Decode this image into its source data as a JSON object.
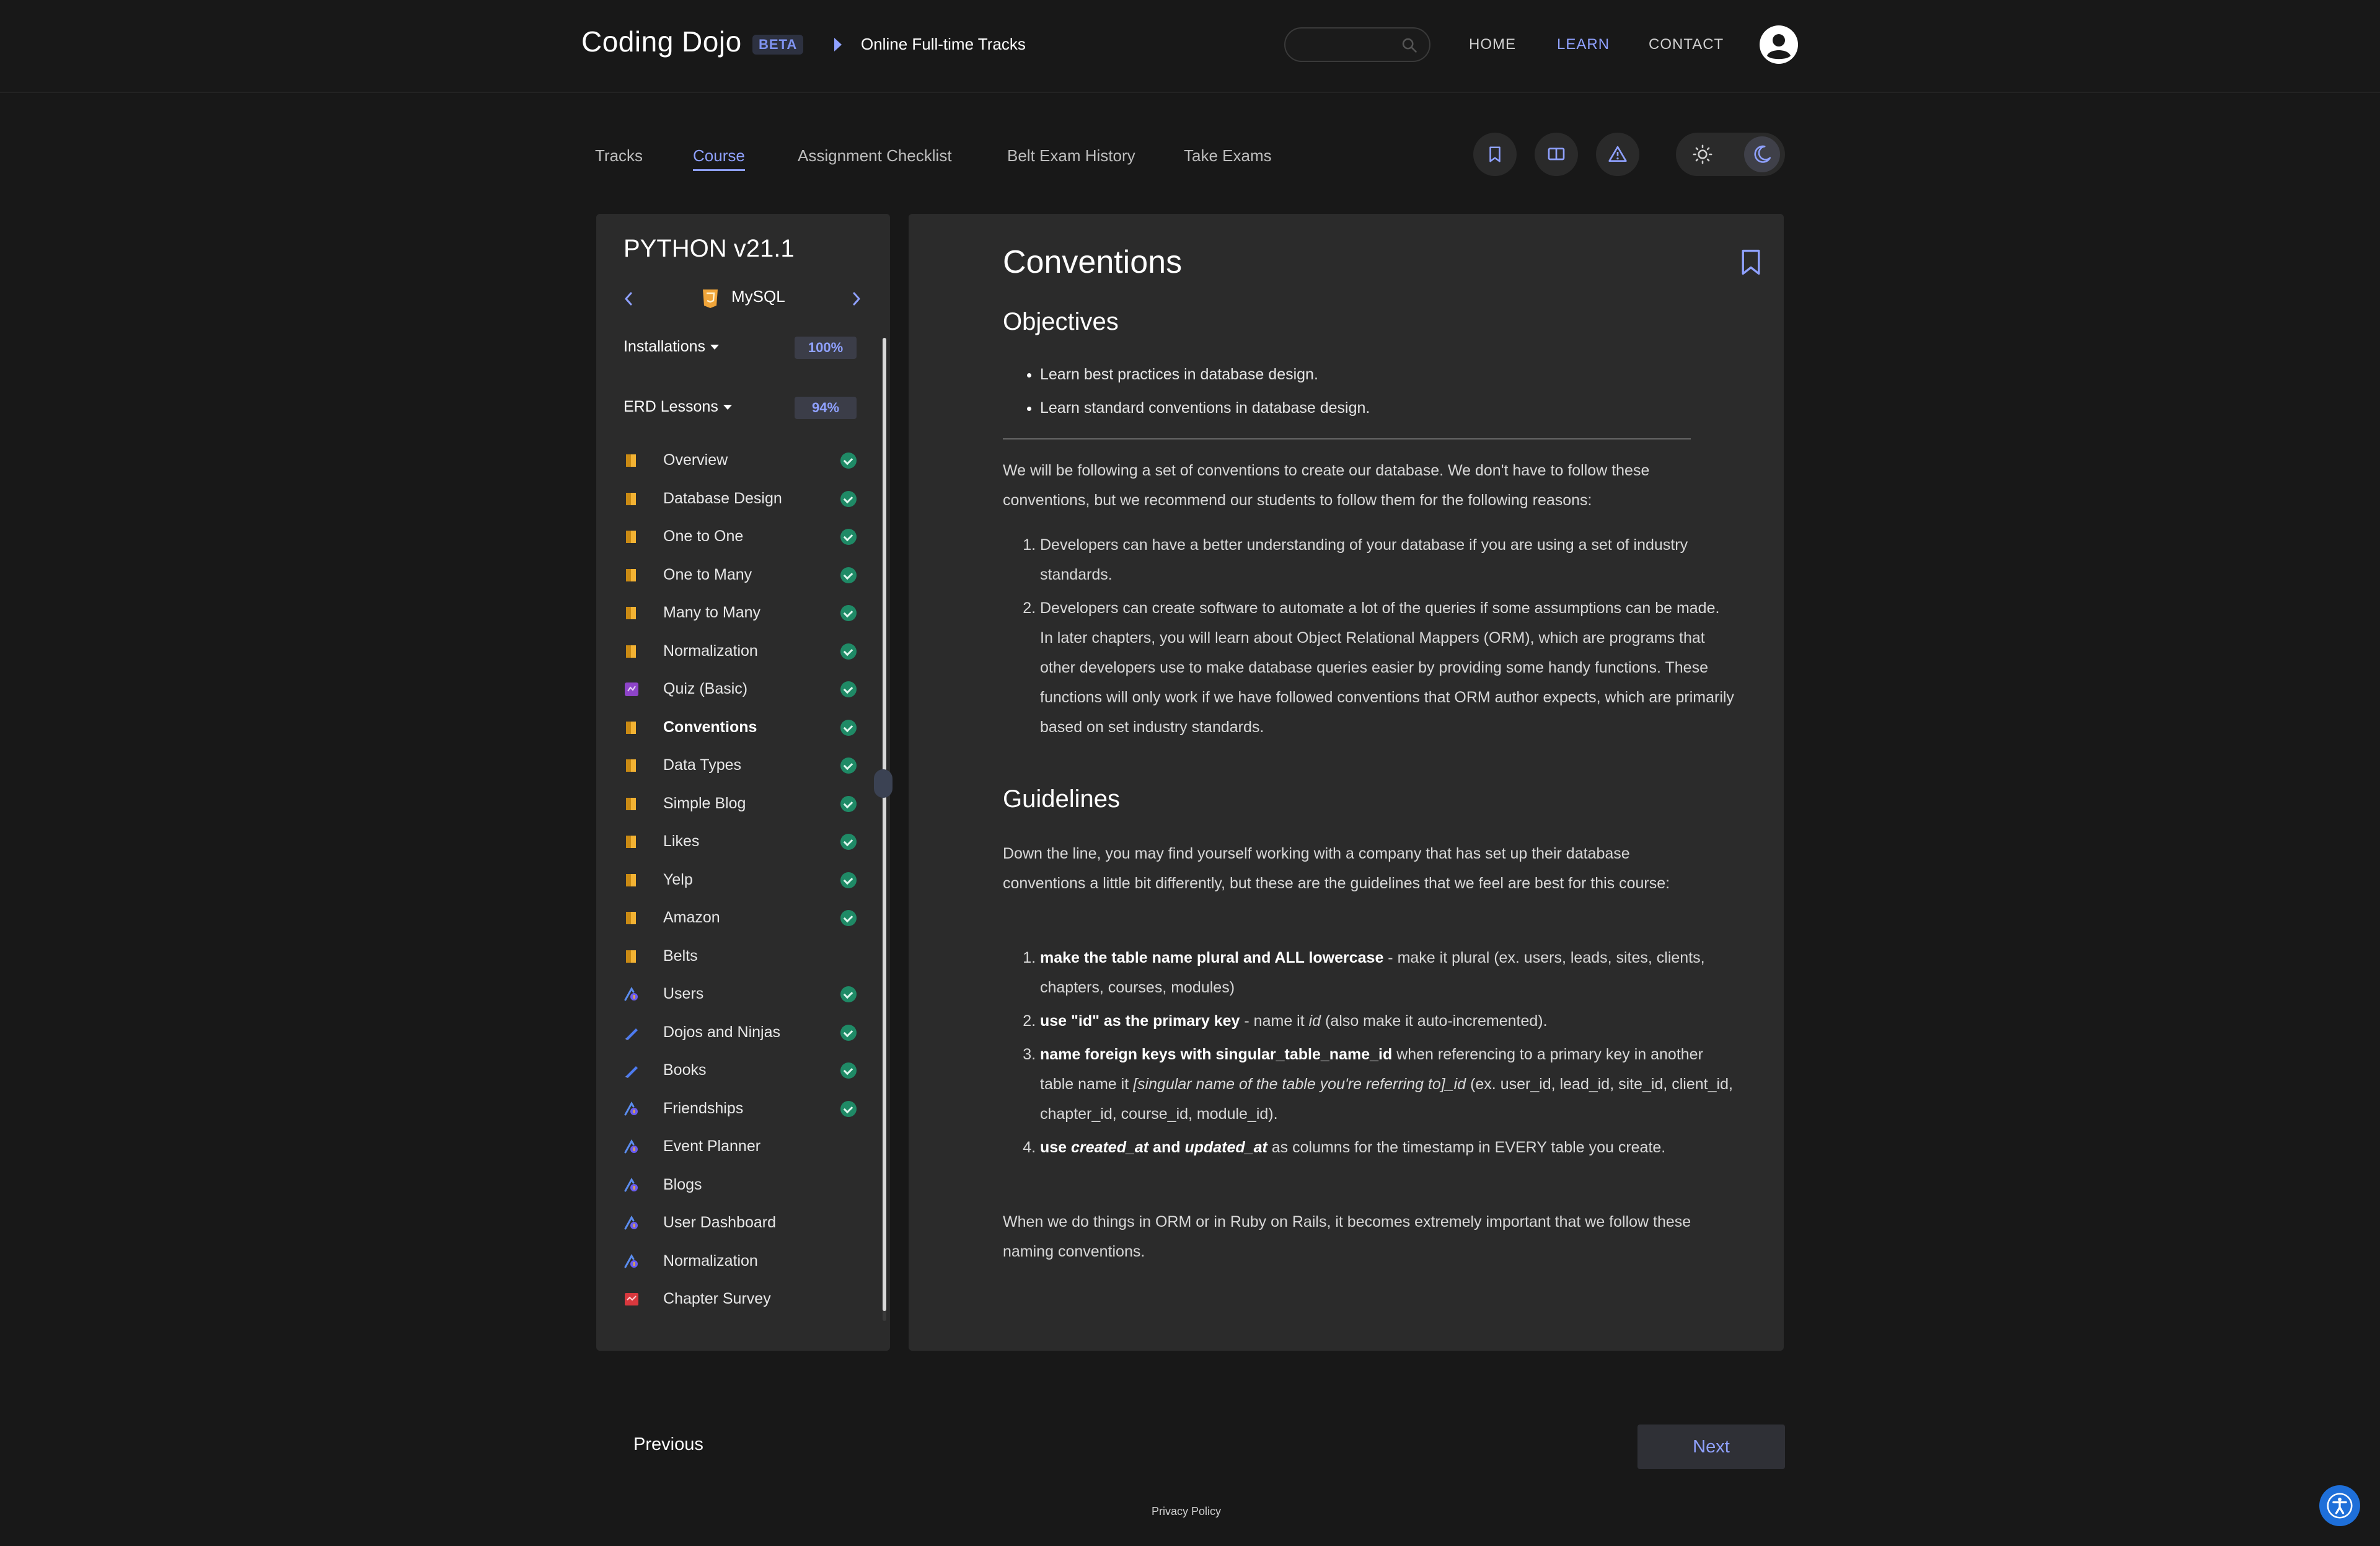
{
  "header": {
    "brand": "Coding Dojo",
    "badge": "BETA",
    "breadcrumb": "Online Full-time Tracks",
    "nav": {
      "home": "HOME",
      "learn": "LEARN",
      "contact": "CONTACT"
    }
  },
  "tabs": [
    "Tracks",
    "Course",
    "Assignment Checklist",
    "Belt Exam History",
    "Take Exams"
  ],
  "sidebar": {
    "course_title": "PYTHON v21.1",
    "chapter": "MySQL",
    "sections": [
      {
        "label": "Installations",
        "percent": "100%"
      },
      {
        "label": "ERD Lessons",
        "percent": "94%"
      }
    ],
    "lessons": [
      {
        "name": "Overview",
        "type": "reading",
        "done": true
      },
      {
        "name": "Database Design",
        "type": "reading",
        "done": true
      },
      {
        "name": "One to One",
        "type": "reading",
        "done": true
      },
      {
        "name": "One to Many",
        "type": "reading",
        "done": true
      },
      {
        "name": "Many to Many",
        "type": "reading",
        "done": true
      },
      {
        "name": "Normalization",
        "type": "reading",
        "done": true
      },
      {
        "name": "Quiz (Basic)",
        "type": "quiz",
        "done": true
      },
      {
        "name": "Conventions",
        "type": "reading",
        "done": true,
        "current": true
      },
      {
        "name": "Data Types",
        "type": "reading",
        "done": true
      },
      {
        "name": "Simple Blog",
        "type": "reading",
        "done": true
      },
      {
        "name": "Likes",
        "type": "reading",
        "done": true
      },
      {
        "name": "Yelp",
        "type": "reading",
        "done": true
      },
      {
        "name": "Amazon",
        "type": "reading",
        "done": true
      },
      {
        "name": "Belts",
        "type": "reading",
        "done": false
      },
      {
        "name": "Users",
        "type": "assignment",
        "done": true
      },
      {
        "name": "Dojos and Ninjas",
        "type": "practice",
        "done": true
      },
      {
        "name": "Books",
        "type": "practice",
        "done": true
      },
      {
        "name": "Friendships",
        "type": "assignment",
        "done": true
      },
      {
        "name": "Event Planner",
        "type": "assignment",
        "done": false
      },
      {
        "name": "Blogs",
        "type": "assignment",
        "done": false
      },
      {
        "name": "User Dashboard",
        "type": "assignment",
        "done": false
      },
      {
        "name": "Normalization",
        "type": "assignment",
        "done": false
      },
      {
        "name": "Chapter Survey",
        "type": "survey",
        "done": false
      }
    ]
  },
  "content": {
    "title": "Conventions",
    "objectives_heading": "Objectives",
    "objectives": [
      "Learn best practices in database design.",
      "Learn standard conventions in database design."
    ],
    "intro": "We will be following a set of conventions to create our database. We don't have to follow these conventions, but we recommend our students to follow them for the following reasons:",
    "reasons": [
      "Developers can have a better understanding of your database if you are using a set of industry standards.",
      "Developers can create software to automate a lot of the queries if some assumptions can be made. In later chapters, you will learn about Object Relational Mappers (ORM), which are programs that other developers use to make database queries easier by providing some handy functions. These functions will only work if we have followed conventions that ORM author expects, which are primarily based on set industry standards."
    ],
    "guidelines_heading": "Guidelines",
    "guidelines_intro": "Down the line, you may find yourself working with a company that has set up their database conventions a little bit differently, but these are the guidelines that we feel are best for this course:",
    "guidelines": {
      "g1_bold": "make the table name plural and ALL lowercase",
      "g1_rest": " - make it plural (ex. users, leads, sites, clients, chapters, courses, modules)",
      "g2_bold": "use \"id\" as the primary key",
      "g2_mid": " - name it ",
      "g2_ital": "id",
      "g2_rest": " (also make it auto-incremented).",
      "g3_bold": "name foreign keys with singular_table_name_id",
      "g3_mid": " when referencing to a primary key in another table name it ",
      "g3_ital": "[singular name of the table you're referring to]_id",
      "g3_rest": " (ex. user_id, lead_id, site_id, client_id, chapter_id, course_id, module_id).",
      "g4_use": "use ",
      "g4_c": "created_at",
      "g4_and": " and ",
      "g4_u": "updated_at",
      "g4_rest": " as columns for the timestamp in EVERY table you create."
    },
    "closing": "When we do things in ORM or in Ruby on Rails, it becomes extremely important that we follow these naming conventions."
  },
  "footer": {
    "previous": "Previous",
    "next": "Next",
    "privacy": "Privacy Policy"
  },
  "colors": {
    "accent": "#8fa1ff",
    "complete": "#1f8a66",
    "reading_icon": "#f2b233",
    "quiz_icon": "#8e44c9",
    "survey_icon": "#d9383e"
  }
}
